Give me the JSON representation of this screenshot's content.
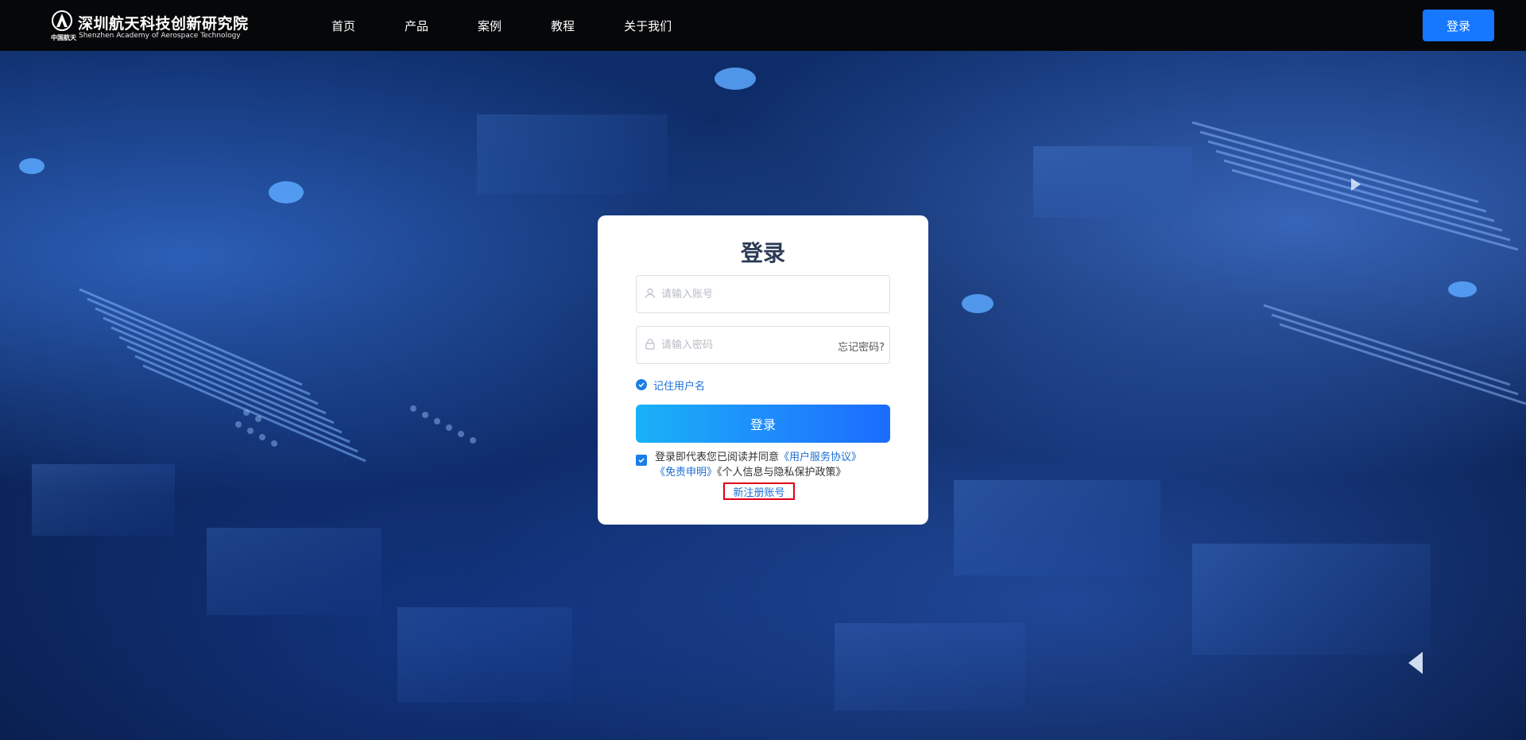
{
  "header": {
    "logo": {
      "title": "深圳航天科技创新研究院",
      "subtitle": "Shenzhen Academy of Aerospace Technology",
      "emblem_text": "中国航天"
    },
    "nav": [
      {
        "label": "首页"
      },
      {
        "label": "产品"
      },
      {
        "label": "案例"
      },
      {
        "label": "教程"
      },
      {
        "label": "关于我们"
      }
    ],
    "login_button": "登录"
  },
  "login": {
    "title": "登录",
    "account_placeholder": "请输入账号",
    "password_placeholder": "请输入密码",
    "forgot": "忘记密码?",
    "remember": "记住用户名",
    "submit": "登录",
    "agreement": {
      "prefix": "登录即代表您已阅读并同意",
      "service": "《用户服务协议》",
      "disclaimer": "《免责申明》",
      "privacy": "《个人信息与隐私保护政策》"
    },
    "register": "新注册账号"
  },
  "colors": {
    "primary": "#1677ff",
    "header_bg": "#060709",
    "link": "#1a6fd6",
    "highlight_border": "#e0001a"
  },
  "icons": [
    "user-icon",
    "lock-icon",
    "check-icon"
  ]
}
